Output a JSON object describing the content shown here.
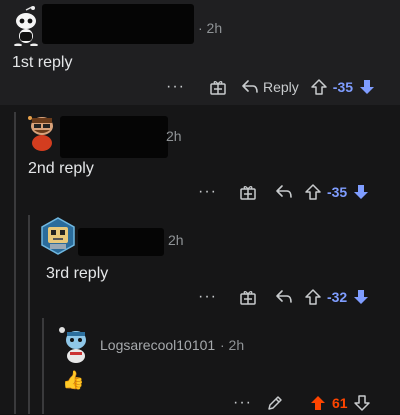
{
  "colors": {
    "downvote_accent": "#7f9dff",
    "upvote_accent": "#ff4500",
    "background": "#121212",
    "comment_bg": "#1f1f21"
  },
  "comments": [
    {
      "level": 1,
      "username": "",
      "time": "· 2h",
      "body": "1st reply",
      "avatar_icon": "snoo-avatar-icon",
      "actions": {
        "more": "···",
        "award_icon": "award-icon",
        "reply_label": "Reply",
        "score": "-35"
      }
    },
    {
      "level": 2,
      "username": "",
      "time": "2h",
      "body": "2nd reply",
      "avatar_icon": "snoo-avatar-icon",
      "actions": {
        "more": "···",
        "award_icon": "award-icon",
        "score": "-35"
      }
    },
    {
      "level": 3,
      "username": "",
      "time": "2h",
      "body": "3rd reply",
      "avatar_icon": "robot-avatar-icon",
      "actions": {
        "more": "···",
        "award_icon": "award-icon",
        "score": "-32"
      }
    },
    {
      "level": 4,
      "username": "Logsarecool10101",
      "time": "· 2h",
      "body": "👍",
      "avatar_icon": "snoo-avatar-icon",
      "actions": {
        "more": "···",
        "edit_icon": "pencil-icon",
        "score": "61"
      }
    }
  ]
}
